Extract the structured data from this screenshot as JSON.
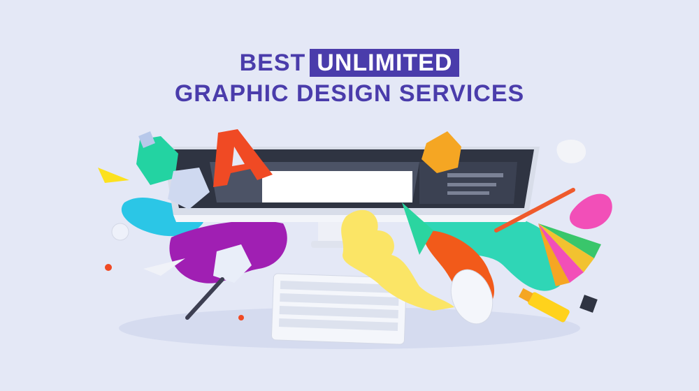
{
  "headline": {
    "line1_prefix": "BEST",
    "line1_highlight": "UNLIMITED",
    "line2": "GRAPHIC DESIGN SERVICES"
  },
  "colors": {
    "background": "#e4e8f6",
    "brand": "#4a3cab",
    "highlight_text": "#ffffff"
  },
  "illustration": {
    "icons": [
      "monitor-icon",
      "keyboard-icon",
      "mouse-icon",
      "letter-a-icon",
      "pencil-icon",
      "highlighter-icon",
      "color-swatch-icon",
      "paint-splash-icon",
      "geometric-shape-icon",
      "binder-clip-icon",
      "pushpin-icon"
    ]
  }
}
